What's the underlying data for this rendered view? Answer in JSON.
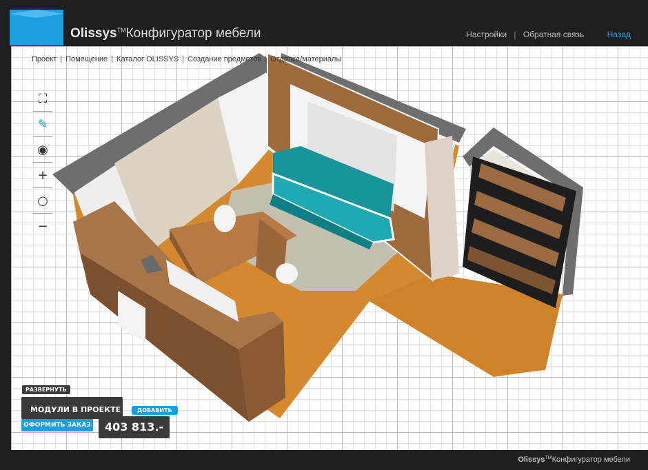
{
  "header": {
    "brand_name": "Olissys",
    "brand_tm": "TM",
    "brand_title": "Конфигуратор мебели",
    "nav": [
      {
        "label": "Настройки"
      },
      {
        "label": "Обратная связь"
      }
    ],
    "back_label": "Назад"
  },
  "breadcrumb": [
    {
      "label": "Проект"
    },
    {
      "label": "Помещение"
    },
    {
      "label": "Каталог OLISSYS"
    },
    {
      "label": "Создание предметов"
    },
    {
      "label": "Отделка/материалы"
    }
  ],
  "toolbar": [
    {
      "icon": "fullscreen-icon",
      "glyph": "⛶"
    },
    {
      "icon": "pencil-icon",
      "glyph": "✎"
    },
    {
      "icon": "eye-icon",
      "glyph": "◉"
    },
    {
      "icon": "zoom-in-icon",
      "glyph": "+"
    },
    {
      "icon": "search-icon",
      "glyph": "○"
    },
    {
      "icon": "zoom-out-icon",
      "glyph": "−"
    }
  ],
  "panel": {
    "expand_label": "РАЗВЕРНУТЬ",
    "modules_label": "МОДУЛИ В ПРОЕКТЕ",
    "add_label": "ДОБАВИТЬ",
    "order_label": "ОФОРМИТЬ ЗАКАЗ",
    "price": "403 813.-"
  },
  "footer": {
    "brand_name": "Olissys",
    "brand_tm": "TM",
    "brand_title": "Конфигуратор мебели"
  },
  "colors": {
    "accent": "#1a9ee0",
    "dark": "#1f1f1f",
    "sofa": "#1fa9b3",
    "floor": "#d88b2f",
    "wood": "#8a5a33"
  }
}
